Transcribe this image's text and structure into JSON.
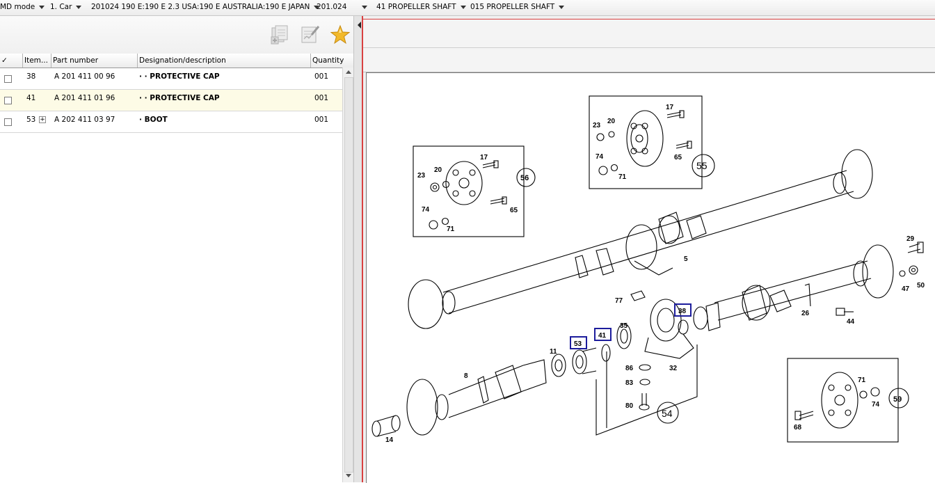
{
  "breadcrumb": {
    "mode": "MD mode",
    "vehicle_class": "1. Car",
    "model": "201024 190 E:190 E 2.3 USA:190 E AUSTRALIA:190 E JAPAN",
    "model_code": "201.024",
    "group": "41 PROPELLER SHAFT",
    "subgroup": "015 PROPELLER SHAFT"
  },
  "toolbar": {
    "icons": [
      "copy-parts-icon",
      "edit-notes-icon",
      "favorite-star-icon"
    ]
  },
  "table": {
    "headers": {
      "check": "✓",
      "item": "Item...",
      "part_number": "Part number",
      "designation": "Designation/description",
      "quantity": "Quantity"
    },
    "rows": [
      {
        "item": "38",
        "part_number": "A 201 411 00 96",
        "designation": "· ·  PROTECTIVE CAP",
        "quantity": "001",
        "selected": false,
        "expandable": false
      },
      {
        "item": "41",
        "part_number": "A 201 411 01 96",
        "designation": "· ·  PROTECTIVE CAP",
        "quantity": "001",
        "selected": true,
        "expandable": false
      },
      {
        "item": "53",
        "part_number": "A 202 411 03 97",
        "designation": "·  BOOT",
        "quantity": "001",
        "selected": false,
        "expandable": true,
        "expand_symbol": "+"
      }
    ]
  },
  "diagram": {
    "highlighted_items": [
      "53",
      "41",
      "38"
    ],
    "circled_groups": [
      "56",
      "55",
      "54",
      "59"
    ],
    "callouts": [
      "17",
      "20",
      "23",
      "74",
      "71",
      "65",
      "5",
      "29",
      "47",
      "50",
      "26",
      "44",
      "77",
      "35",
      "11",
      "8",
      "14",
      "86",
      "83",
      "80",
      "32",
      "68"
    ]
  },
  "colors": {
    "highlight_border": "#1c1c9c",
    "selected_row": "#fdfbe6",
    "splitter_accent": "#d94040"
  }
}
